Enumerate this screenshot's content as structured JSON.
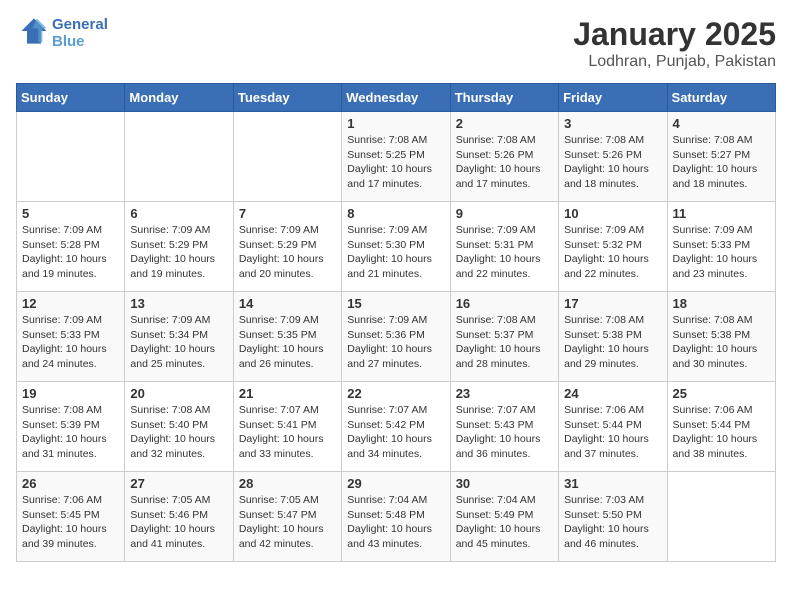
{
  "logo": {
    "line1": "General",
    "line2": "Blue"
  },
  "title": "January 2025",
  "subtitle": "Lodhran, Punjab, Pakistan",
  "weekdays": [
    "Sunday",
    "Monday",
    "Tuesday",
    "Wednesday",
    "Thursday",
    "Friday",
    "Saturday"
  ],
  "weeks": [
    [
      {
        "day": "",
        "info": ""
      },
      {
        "day": "",
        "info": ""
      },
      {
        "day": "",
        "info": ""
      },
      {
        "day": "1",
        "info": "Sunrise: 7:08 AM\nSunset: 5:25 PM\nDaylight: 10 hours\nand 17 minutes."
      },
      {
        "day": "2",
        "info": "Sunrise: 7:08 AM\nSunset: 5:26 PM\nDaylight: 10 hours\nand 17 minutes."
      },
      {
        "day": "3",
        "info": "Sunrise: 7:08 AM\nSunset: 5:26 PM\nDaylight: 10 hours\nand 18 minutes."
      },
      {
        "day": "4",
        "info": "Sunrise: 7:08 AM\nSunset: 5:27 PM\nDaylight: 10 hours\nand 18 minutes."
      }
    ],
    [
      {
        "day": "5",
        "info": "Sunrise: 7:09 AM\nSunset: 5:28 PM\nDaylight: 10 hours\nand 19 minutes."
      },
      {
        "day": "6",
        "info": "Sunrise: 7:09 AM\nSunset: 5:29 PM\nDaylight: 10 hours\nand 19 minutes."
      },
      {
        "day": "7",
        "info": "Sunrise: 7:09 AM\nSunset: 5:29 PM\nDaylight: 10 hours\nand 20 minutes."
      },
      {
        "day": "8",
        "info": "Sunrise: 7:09 AM\nSunset: 5:30 PM\nDaylight: 10 hours\nand 21 minutes."
      },
      {
        "day": "9",
        "info": "Sunrise: 7:09 AM\nSunset: 5:31 PM\nDaylight: 10 hours\nand 22 minutes."
      },
      {
        "day": "10",
        "info": "Sunrise: 7:09 AM\nSunset: 5:32 PM\nDaylight: 10 hours\nand 22 minutes."
      },
      {
        "day": "11",
        "info": "Sunrise: 7:09 AM\nSunset: 5:33 PM\nDaylight: 10 hours\nand 23 minutes."
      }
    ],
    [
      {
        "day": "12",
        "info": "Sunrise: 7:09 AM\nSunset: 5:33 PM\nDaylight: 10 hours\nand 24 minutes."
      },
      {
        "day": "13",
        "info": "Sunrise: 7:09 AM\nSunset: 5:34 PM\nDaylight: 10 hours\nand 25 minutes."
      },
      {
        "day": "14",
        "info": "Sunrise: 7:09 AM\nSunset: 5:35 PM\nDaylight: 10 hours\nand 26 minutes."
      },
      {
        "day": "15",
        "info": "Sunrise: 7:09 AM\nSunset: 5:36 PM\nDaylight: 10 hours\nand 27 minutes."
      },
      {
        "day": "16",
        "info": "Sunrise: 7:08 AM\nSunset: 5:37 PM\nDaylight: 10 hours\nand 28 minutes."
      },
      {
        "day": "17",
        "info": "Sunrise: 7:08 AM\nSunset: 5:38 PM\nDaylight: 10 hours\nand 29 minutes."
      },
      {
        "day": "18",
        "info": "Sunrise: 7:08 AM\nSunset: 5:38 PM\nDaylight: 10 hours\nand 30 minutes."
      }
    ],
    [
      {
        "day": "19",
        "info": "Sunrise: 7:08 AM\nSunset: 5:39 PM\nDaylight: 10 hours\nand 31 minutes."
      },
      {
        "day": "20",
        "info": "Sunrise: 7:08 AM\nSunset: 5:40 PM\nDaylight: 10 hours\nand 32 minutes."
      },
      {
        "day": "21",
        "info": "Sunrise: 7:07 AM\nSunset: 5:41 PM\nDaylight: 10 hours\nand 33 minutes."
      },
      {
        "day": "22",
        "info": "Sunrise: 7:07 AM\nSunset: 5:42 PM\nDaylight: 10 hours\nand 34 minutes."
      },
      {
        "day": "23",
        "info": "Sunrise: 7:07 AM\nSunset: 5:43 PM\nDaylight: 10 hours\nand 36 minutes."
      },
      {
        "day": "24",
        "info": "Sunrise: 7:06 AM\nSunset: 5:44 PM\nDaylight: 10 hours\nand 37 minutes."
      },
      {
        "day": "25",
        "info": "Sunrise: 7:06 AM\nSunset: 5:44 PM\nDaylight: 10 hours\nand 38 minutes."
      }
    ],
    [
      {
        "day": "26",
        "info": "Sunrise: 7:06 AM\nSunset: 5:45 PM\nDaylight: 10 hours\nand 39 minutes."
      },
      {
        "day": "27",
        "info": "Sunrise: 7:05 AM\nSunset: 5:46 PM\nDaylight: 10 hours\nand 41 minutes."
      },
      {
        "day": "28",
        "info": "Sunrise: 7:05 AM\nSunset: 5:47 PM\nDaylight: 10 hours\nand 42 minutes."
      },
      {
        "day": "29",
        "info": "Sunrise: 7:04 AM\nSunset: 5:48 PM\nDaylight: 10 hours\nand 43 minutes."
      },
      {
        "day": "30",
        "info": "Sunrise: 7:04 AM\nSunset: 5:49 PM\nDaylight: 10 hours\nand 45 minutes."
      },
      {
        "day": "31",
        "info": "Sunrise: 7:03 AM\nSunset: 5:50 PM\nDaylight: 10 hours\nand 46 minutes."
      },
      {
        "day": "",
        "info": ""
      }
    ]
  ]
}
